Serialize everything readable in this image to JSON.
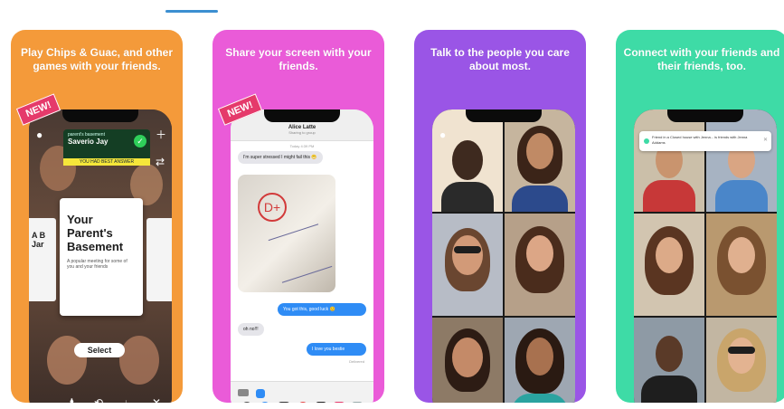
{
  "cards": [
    {
      "headline": "Play Chips & Guac, and other games with your friends.",
      "badge": "NEW!",
      "game": {
        "banner_small": "parent's basement",
        "banner_name": "Saverio Jay",
        "banner_sub": "YOU HAD BEST ANSWER",
        "card_title": "Your Parent's Basement",
        "card_desc": "A popular meeting for some of you and your friends",
        "side_card_title": "A B Jar",
        "select_label": "Select"
      },
      "colors": {
        "bg": "#f49a3a"
      }
    },
    {
      "headline": "Share your screen with your friends.",
      "badge": "NEW!",
      "messages": {
        "contact_name": "Alice Latte",
        "contact_sub": "Sharing to group",
        "timestamp": "Today 4:39 PM",
        "incoming_1": "I'm super stressed I might fail this 😬",
        "outgoing_1": "You got this, good luck 😊",
        "incoming_2": "oh no!!!",
        "outgoing_2": "I love you bestie",
        "receipt": "Delivered"
      },
      "colors": {
        "bg": "#ea5bd8"
      }
    },
    {
      "headline": "Talk to the people you care about most.",
      "colors": {
        "bg": "#9a55e6"
      }
    },
    {
      "headline": "Connect with your friends and their friends, too.",
      "notification": "Friend in a Closed house with Jenna... is friends with Jenna Addams",
      "colors": {
        "bg": "#3edba6"
      }
    }
  ]
}
